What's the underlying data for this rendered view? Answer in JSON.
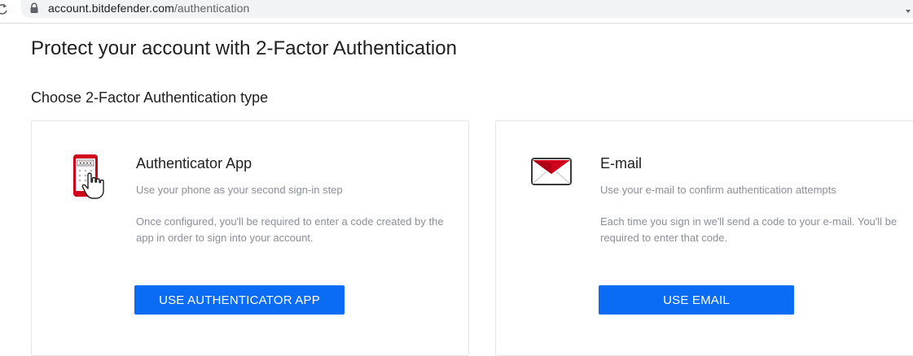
{
  "browser": {
    "url_host": "account.bitdefender.com",
    "url_path": "/authentication"
  },
  "page": {
    "title": "Protect your account with 2-Factor Authentication",
    "section_title": "Choose 2-Factor Authentication type"
  },
  "options": [
    {
      "icon": "authenticator-app-icon",
      "icon_code_text": "XXXX",
      "title": "Authenticator App",
      "subtitle": "Use your phone as your second sign-in step",
      "description": "Once configured, you'll be required to enter a code created by the app in order to sign into your account.",
      "button_label": "USE AUTHENTICATOR APP"
    },
    {
      "icon": "envelope-icon",
      "title": "E-mail",
      "subtitle": "Use your e-mail to confirm authentication attempts",
      "description": "Each time you sign in we'll send a code to your e-mail. You'll be required to enter that code.",
      "button_label": "USE EMAIL"
    }
  ],
  "colors": {
    "accent": "#0a6cf5",
    "brand_red": "#d0021b",
    "muted_text": "#8a8f98"
  }
}
